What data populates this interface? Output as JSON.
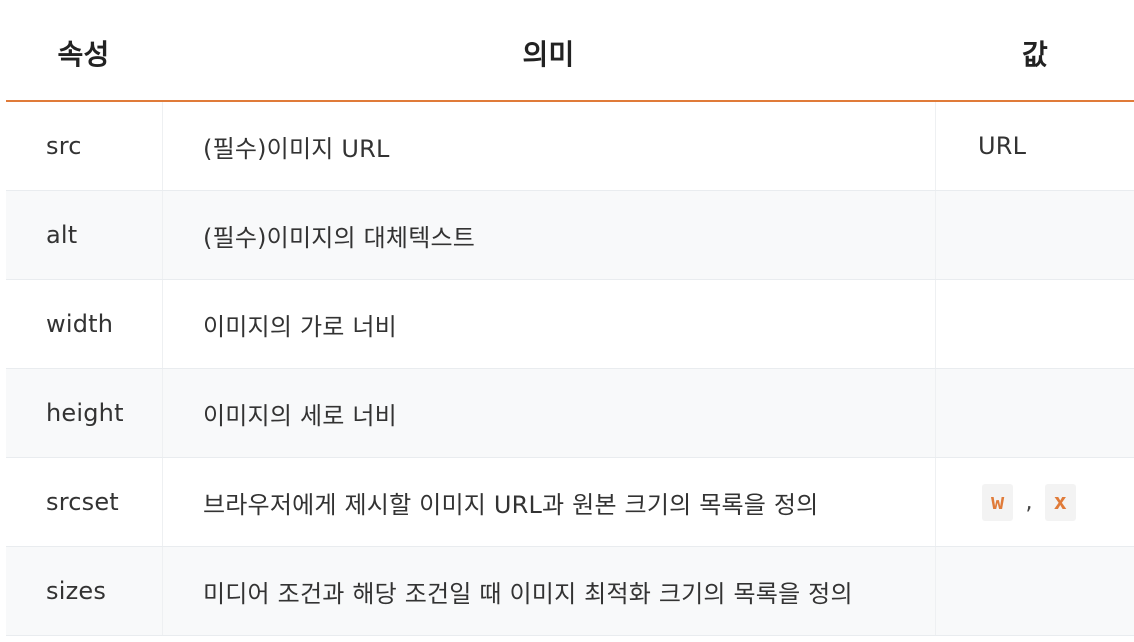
{
  "header": {
    "attribute": "속성",
    "meaning": "의미",
    "value": "값"
  },
  "rows": [
    {
      "attribute": "src",
      "meaning": "(필수)이미지 URL",
      "value": "URL"
    },
    {
      "attribute": "alt",
      "meaning": "(필수)이미지의 대체텍스트",
      "value": ""
    },
    {
      "attribute": "width",
      "meaning": "이미지의 가로 너비",
      "value": ""
    },
    {
      "attribute": "height",
      "meaning": "이미지의 세로 너비",
      "value": ""
    },
    {
      "attribute": "srcset",
      "meaning": "브라우저에게 제시할 이미지 URL과 원본 크기의 목록을 정의",
      "value_codes": [
        "w",
        "x"
      ],
      "value_separator": ","
    },
    {
      "attribute": "sizes",
      "meaning": "미디어 조건과 해당 조건일 때 이미지 최적화 크기의 목록을 정의",
      "value": ""
    }
  ]
}
